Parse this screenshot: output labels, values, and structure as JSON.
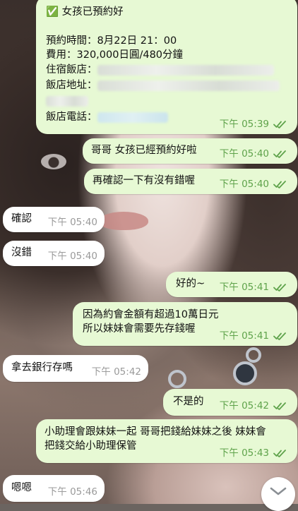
{
  "messages": [
    {
      "id": "m1",
      "dir": "out",
      "lines": [
        {
          "type": "text",
          "text": "✅ 女孩已預約好"
        },
        {
          "type": "spacer"
        },
        {
          "type": "text",
          "text": "預約時間：8月22日 21：00"
        },
        {
          "type": "text",
          "text": "費用：320,000日圓/480分鐘"
        },
        {
          "type": "redacted",
          "label": "住宿飯店："
        },
        {
          "type": "redacted",
          "label": "飯店地址："
        },
        {
          "type": "redacted",
          "label": ""
        },
        {
          "type": "redacted",
          "label": "飯店電話："
        }
      ],
      "time": "下午 05:39"
    },
    {
      "id": "m2",
      "dir": "out",
      "text": "哥哥 女孩已經預約好啦",
      "time": "下午 05:40"
    },
    {
      "id": "m3",
      "dir": "out",
      "text": "再確認一下有沒有錯喔",
      "time": "下午 05:40"
    },
    {
      "id": "m4",
      "dir": "in",
      "text": "確認",
      "time": "下午 05:40"
    },
    {
      "id": "m5",
      "dir": "in",
      "text": "沒錯",
      "time": "下午 05:40"
    },
    {
      "id": "m6",
      "dir": "out",
      "text": "好的~",
      "time": "下午 05:41"
    },
    {
      "id": "m7",
      "dir": "out",
      "text": "因為約會金額有超過10萬日元\n所以妹妹會需要先存錢喔",
      "time": "下午 05:41"
    },
    {
      "id": "m8",
      "dir": "in",
      "text": "拿去銀行存嗎",
      "time": "下午 05:42"
    },
    {
      "id": "m9",
      "dir": "out",
      "text": "不是的",
      "time": "下午 05:42"
    },
    {
      "id": "m10",
      "dir": "out",
      "text": "小助理會跟妹妹一起 哥哥把錢給妹妹之後 妹妹會\n把錢交給小助理保管",
      "time": "下午 05:43"
    },
    {
      "id": "m11",
      "dir": "in",
      "text": "嗯嗯",
      "time": "下午 05:46"
    }
  ],
  "icons": {
    "check": "double-check-icon",
    "scroll": "chevron-down-icon"
  },
  "colors": {
    "outgoing_bubble": "#e7f9d4",
    "incoming_bubble": "#ffffff",
    "read_ticks": "#5fa34b"
  }
}
